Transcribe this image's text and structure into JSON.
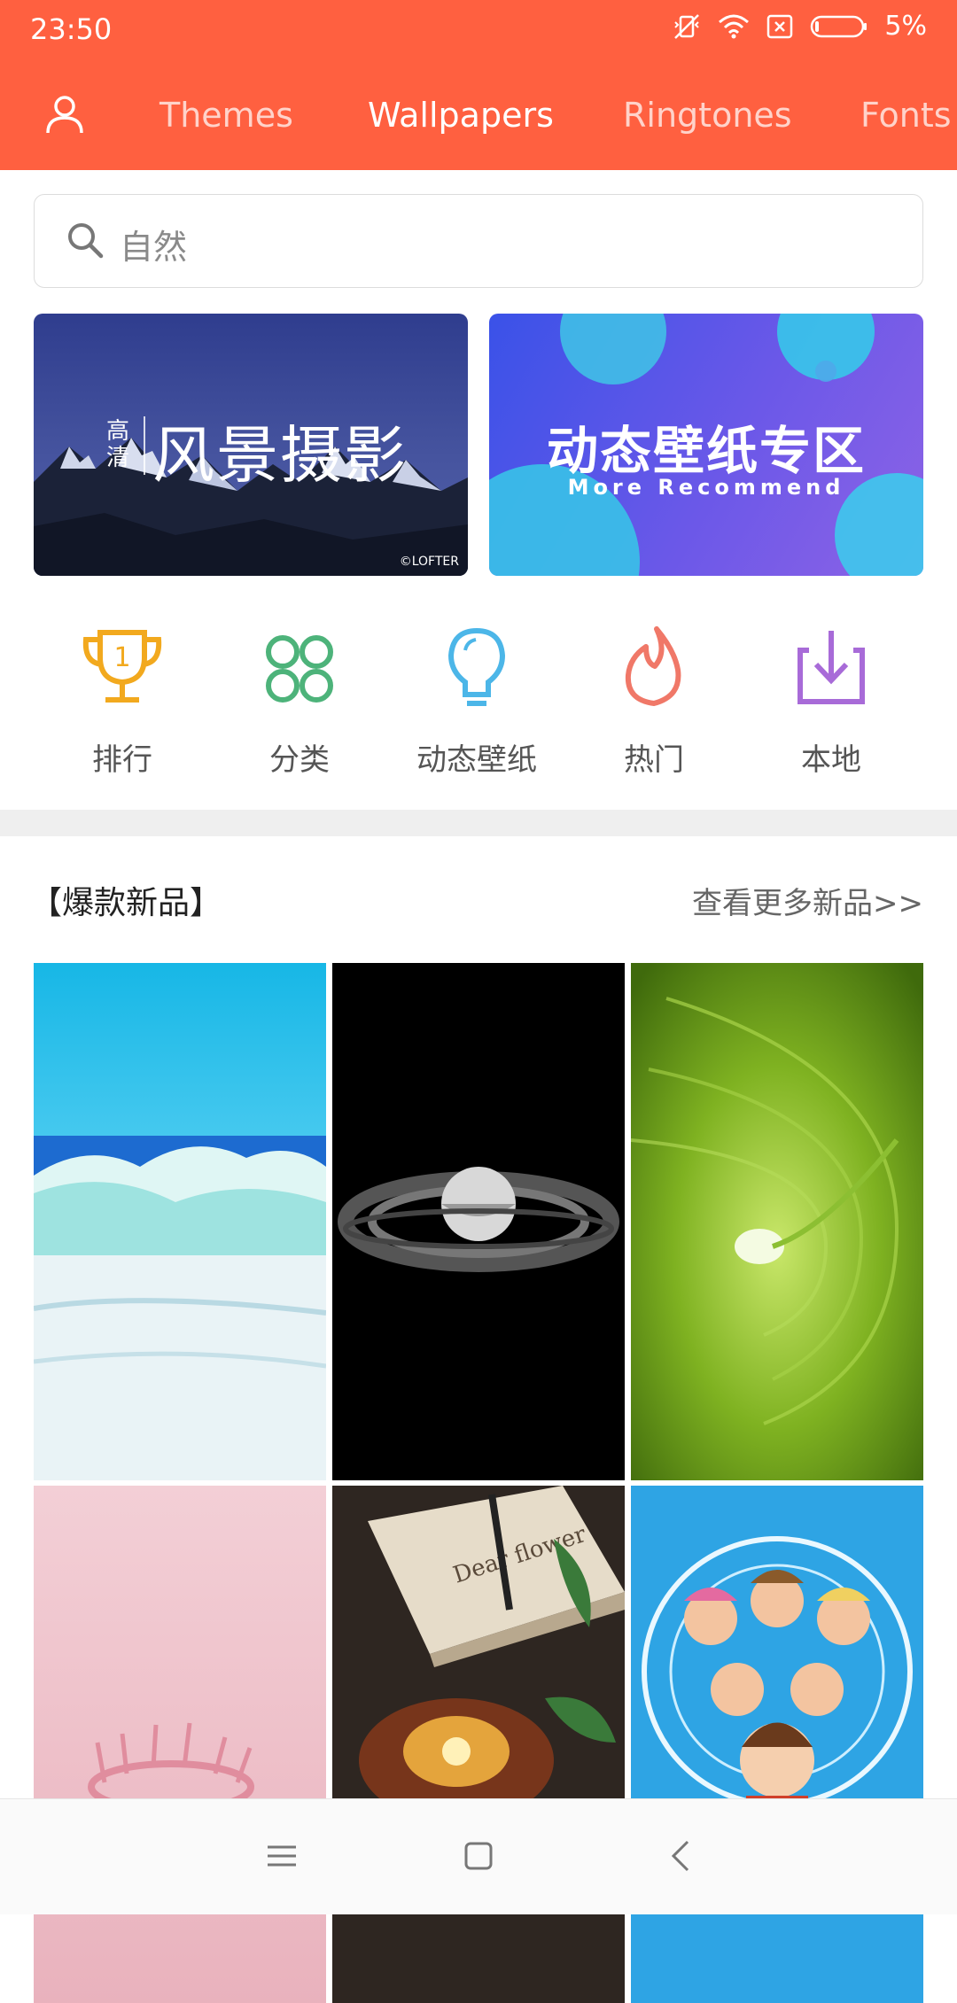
{
  "status_bar": {
    "time": "23:50",
    "battery_percent": "5%"
  },
  "top_nav": {
    "tabs": [
      {
        "label": "Themes",
        "active": false
      },
      {
        "label": "Wallpapers",
        "active": true
      },
      {
        "label": "Ringtones",
        "active": false
      },
      {
        "label": "Fonts",
        "active": false
      }
    ]
  },
  "search": {
    "placeholder": "自然"
  },
  "banners": [
    {
      "hd_label": "高清",
      "title": "风景摄影",
      "credit": "©LOFTER"
    },
    {
      "title": "动态壁纸专区",
      "subtitle": "More Recommend"
    }
  ],
  "categories": [
    {
      "label": "排行",
      "icon": "trophy-icon",
      "color": "#F2A91E"
    },
    {
      "label": "分类",
      "icon": "grid-circles-icon",
      "color": "#4DB37A"
    },
    {
      "label": "动态壁纸",
      "icon": "lightbulb-icon",
      "color": "#4CB6E8"
    },
    {
      "label": "热门",
      "icon": "flame-icon",
      "color": "#F07868"
    },
    {
      "label": "本地",
      "icon": "download-icon",
      "color": "#A86BD8"
    }
  ],
  "section": {
    "title": "【爆款新品】",
    "more_link": "查看更多新品>>"
  },
  "accent_color": "#FF6040"
}
